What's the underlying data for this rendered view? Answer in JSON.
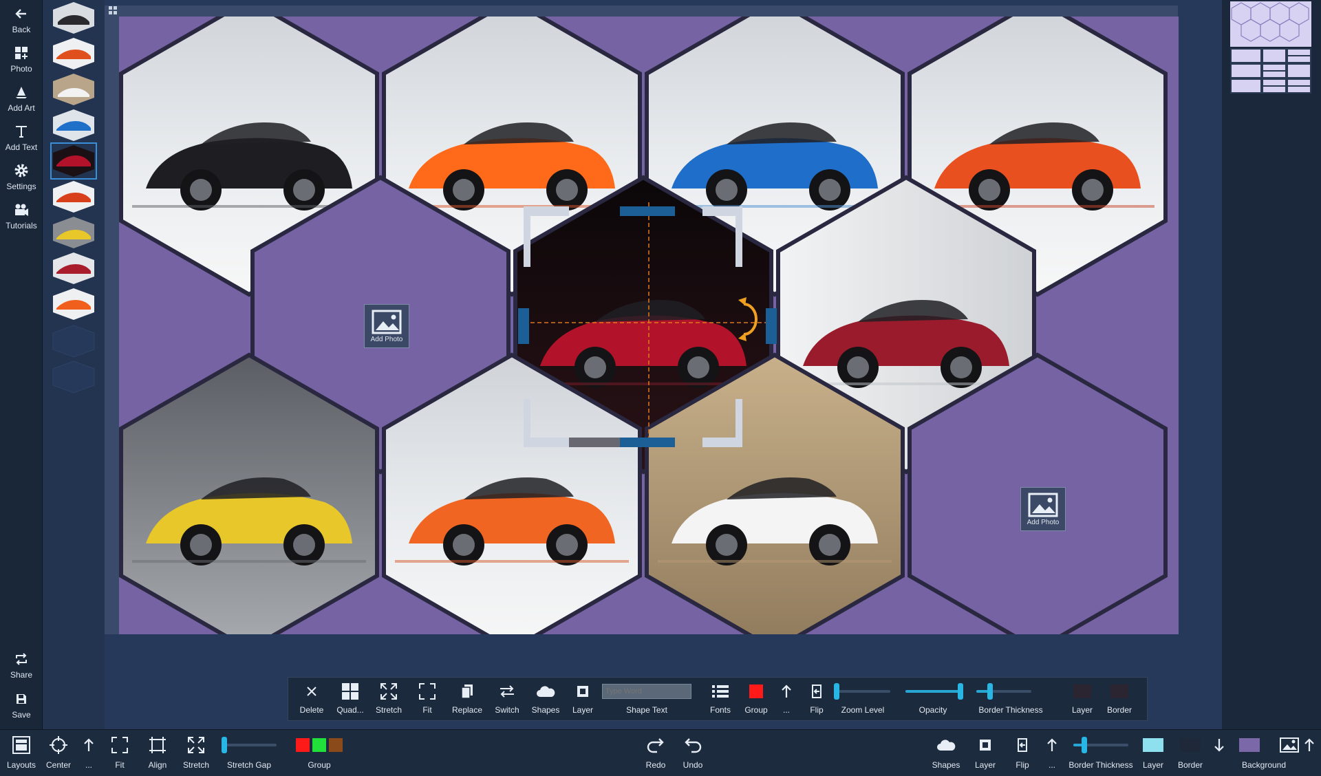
{
  "nav": {
    "items": [
      {
        "id": "back",
        "label": "Back",
        "icon": "arrow-left-icon"
      },
      {
        "id": "photo",
        "label": "Photo",
        "icon": "photo-grid-icon"
      },
      {
        "id": "addart",
        "label": "Add Art",
        "icon": "sailboat-icon"
      },
      {
        "id": "addtext",
        "label": "Add Text",
        "icon": "text-t-icon"
      },
      {
        "id": "settings",
        "label": "Settings",
        "icon": "gear-icon"
      },
      {
        "id": "tutorials",
        "label": "Tutorials",
        "icon": "video-camera-icon"
      }
    ],
    "share_label": "Share",
    "save_label": "Save"
  },
  "canvas": {
    "background_color": "#7563a4",
    "add_photo_label": "Add Photo"
  },
  "cells": [
    {
      "color": "#5b5d63",
      "accent": "#1e1e22"
    },
    {
      "color": "#d8532a",
      "accent": "#ff6a1a"
    },
    {
      "color": "#4b8dd0",
      "accent": "#1f6ec9"
    },
    {
      "color": "#c9452c",
      "accent": "#e8501f"
    },
    {
      "color": "#7d1d2b",
      "accent": "#b3132a"
    },
    {
      "color": "#c0c4c8",
      "accent": "#9a1c2c"
    },
    {
      "color": "#6a6e72",
      "accent": "#e8c72a"
    },
    {
      "color": "#d55a2c",
      "accent": "#f06522"
    },
    {
      "color": "#b89a74",
      "accent": "#f4f4f4"
    }
  ],
  "floatbar": {
    "delete_label": "Delete",
    "quad_label": "Quad...",
    "stretch_label": "Stretch",
    "fit_label": "Fit",
    "replace_label": "Replace",
    "switch_label": "Switch",
    "shapes_label": "Shapes",
    "layer_label": "Layer",
    "shape_text_label": "Shape Text",
    "shape_text_placeholder": "Type Word",
    "fonts_label": "Fonts",
    "group_label": "Group",
    "more_label": "...",
    "flip_label": "Flip",
    "zoom_label": "Zoom Level",
    "zoom_level": 0.02,
    "opacity_label": "Opacity",
    "opacity": 1.0,
    "border_thickness_label": "Border Thickness",
    "border_thickness": 0.25,
    "layer2_label": "Layer",
    "border_label": "Border",
    "group_color": "#ff1a1a"
  },
  "bottombar": {
    "layouts_label": "Layouts",
    "center_label": "Center",
    "more_label": "...",
    "fit_label": "Fit",
    "align_label": "Align",
    "stretch_label": "Stretch",
    "stretch_gap_label": "Stretch Gap",
    "stretch_gap": 0.05,
    "group_label": "Group",
    "group_colors": [
      "#ff1a1a",
      "#22e03a",
      "#8a4a1a"
    ],
    "redo_label": "Redo",
    "undo_label": "Undo",
    "shapes_label": "Shapes",
    "layer_label": "Layer",
    "flip_label": "Flip",
    "more2_label": "...",
    "border_thickness_label": "Border Thickness",
    "border_thickness": 0.2,
    "layer2_label": "Layer",
    "layer_color": "#8fe0ee",
    "border_label": "Border",
    "border_color": "#1e2838",
    "background_label": "Background",
    "background_color": "#7a68a8"
  }
}
